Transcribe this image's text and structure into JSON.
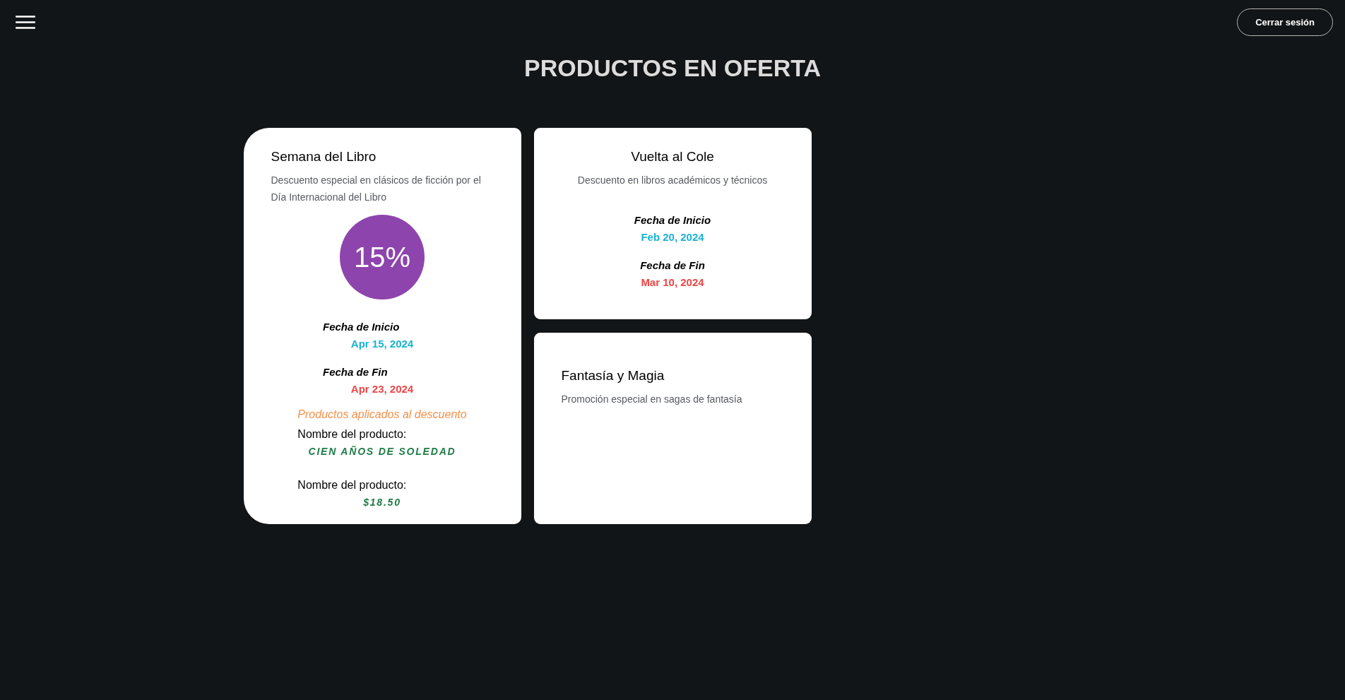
{
  "header": {
    "logout_button": "Cerrar sesión"
  },
  "page_title": "PRODUCTOS EN OFERTA",
  "offers": [
    {
      "kind": "featured",
      "title": "Semana del Libro",
      "description": "Descuento especial en clásicos de ficción por el Día Internacional del Libro",
      "discount": "15%",
      "dates": [
        {
          "kind": "start",
          "label": "Fecha de Inicio",
          "value": "Apr 15, 2024"
        },
        {
          "kind": "end",
          "label": "Fecha de Fin",
          "value": "Apr 23, 2024"
        }
      ],
      "products_heading": "Productos aplicados al descuento",
      "products": [
        {
          "label": "Nombre del producto:",
          "value": "CIEN AÑOS DE SOLEDAD"
        },
        {
          "label": "Nombre del producto:",
          "value": "$18.50"
        }
      ]
    },
    {
      "kind": "centered",
      "title": "Vuelta al Cole",
      "description": "Descuento en libros académicos y técnicos",
      "dates": [
        {
          "kind": "start",
          "label": "Fecha de Inicio",
          "value": "Feb 20, 2024"
        },
        {
          "kind": "end",
          "label": "Fecha de Fin",
          "value": "Mar 10, 2024"
        }
      ]
    },
    {
      "kind": "plain",
      "title": "Fantasía y Magia",
      "description": "Promoción especial en sagas de fantasía"
    }
  ]
}
